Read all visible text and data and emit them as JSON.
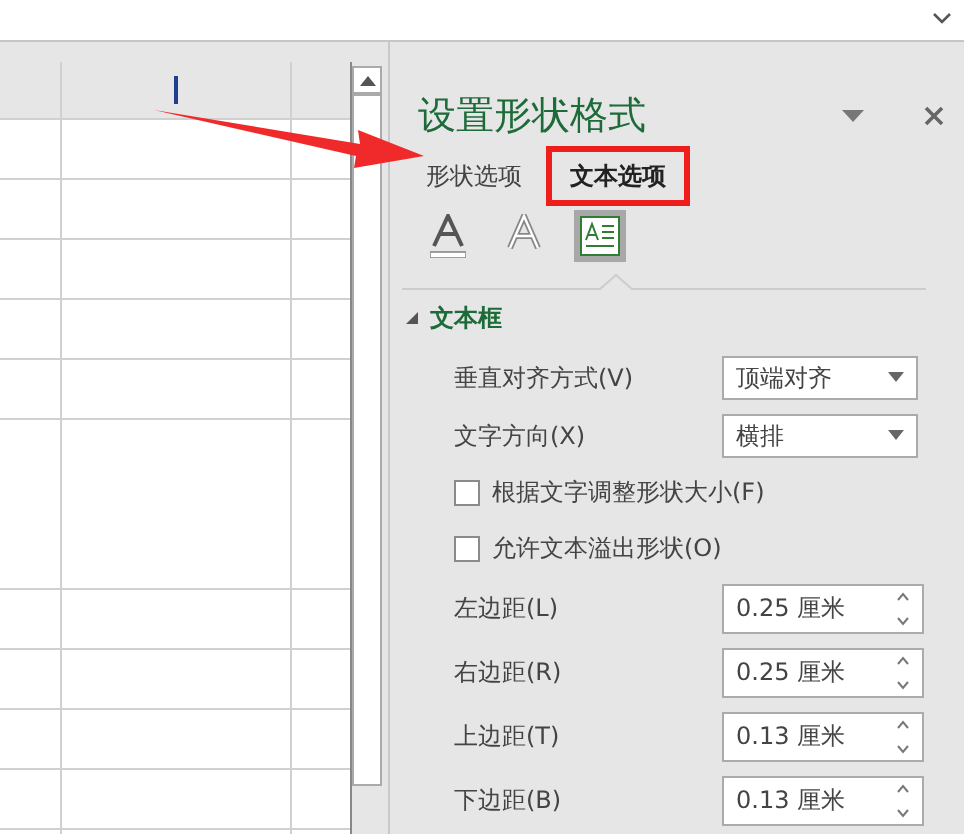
{
  "panel": {
    "title": "设置形状格式",
    "tabs": [
      {
        "label": "形状选项",
        "selected": false,
        "highlighted": false
      },
      {
        "label": "文本选项",
        "selected": true,
        "highlighted": true
      }
    ],
    "icon_tabs": [
      {
        "kind": "fill",
        "selected": false
      },
      {
        "kind": "effects",
        "selected": false
      },
      {
        "kind": "textbox",
        "selected": true
      }
    ],
    "section": {
      "title": "文本框",
      "expanded": true,
      "fields": [
        {
          "kind": "dropdown",
          "label": "垂直对齐方式(V)",
          "value": "顶端对齐"
        },
        {
          "kind": "dropdown",
          "label": "文字方向(X)",
          "value": "横排"
        },
        {
          "kind": "checkbox",
          "label": "根据文字调整形状大小(F)",
          "checked": false
        },
        {
          "kind": "checkbox",
          "label": "允许文本溢出形状(O)",
          "checked": false
        },
        {
          "kind": "spinner",
          "label": "左边距(L)",
          "value": "0.25 厘米"
        },
        {
          "kind": "spinner",
          "label": "右边距(R)",
          "value": "0.25 厘米"
        },
        {
          "kind": "spinner",
          "label": "上边距(T)",
          "value": "0.13 厘米"
        },
        {
          "kind": "spinner",
          "label": "下边距(B)",
          "value": "0.13 厘米"
        }
      ]
    }
  }
}
